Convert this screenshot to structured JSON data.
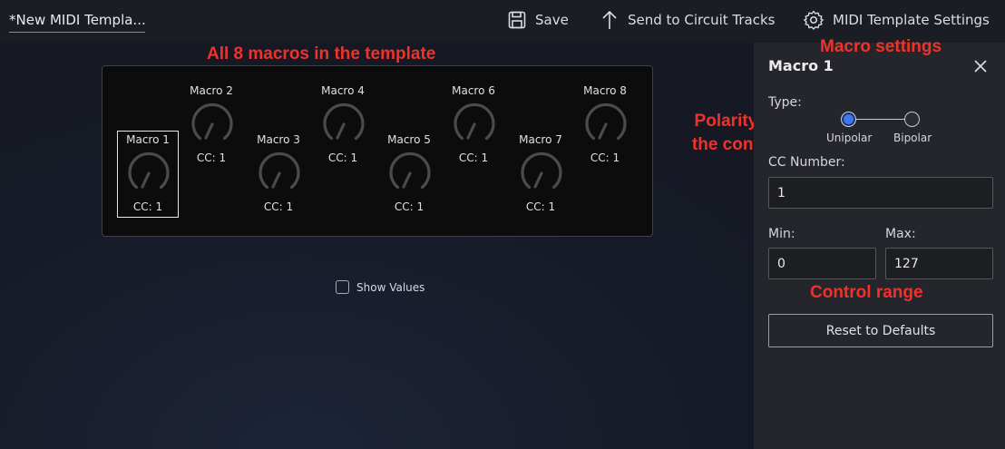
{
  "header": {
    "template_name": "*New MIDI Templa...",
    "save_label": "Save",
    "send_label": "Send to Circuit Tracks",
    "settings_label": "MIDI Template Settings"
  },
  "annotations": {
    "macros": "All 8 macros in the template",
    "settings": "Macro settings",
    "polarity_line1": "Polarity of",
    "polarity_line2": "the control",
    "range": "Control range"
  },
  "macros": [
    {
      "name": "Macro 1",
      "cc": "CC: 1",
      "selected": true
    },
    {
      "name": "Macro 2",
      "cc": "CC: 1"
    },
    {
      "name": "Macro 3",
      "cc": "CC: 1"
    },
    {
      "name": "Macro 4",
      "cc": "CC: 1"
    },
    {
      "name": "Macro 5",
      "cc": "CC: 1"
    },
    {
      "name": "Macro 6",
      "cc": "CC: 1"
    },
    {
      "name": "Macro 7",
      "cc": "CC: 1"
    },
    {
      "name": "Macro 8",
      "cc": "CC: 1"
    }
  ],
  "show_values": {
    "label": "Show Values",
    "checked": false
  },
  "panel": {
    "title": "Macro 1",
    "type_label": "Type:",
    "unipolar_label": "Unipolar",
    "bipolar_label": "Bipolar",
    "selected_type": "Unipolar",
    "cc_label": "CC Number:",
    "cc_value": "1",
    "min_label": "Min:",
    "min_value": "0",
    "max_label": "Max:",
    "max_value": "127",
    "reset_label": "Reset to Defaults"
  },
  "colors": {
    "accent": "#3f78e9",
    "annotation": "#f0322a"
  }
}
